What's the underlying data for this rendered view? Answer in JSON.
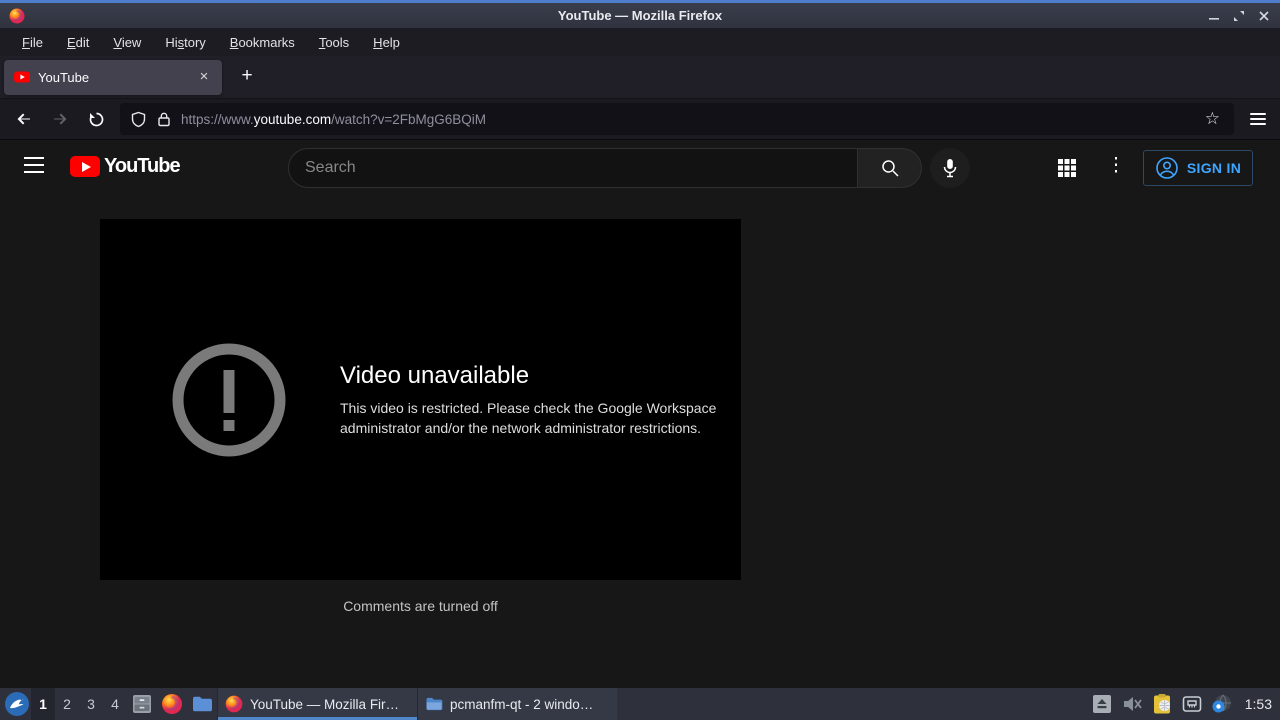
{
  "window": {
    "title": "YouTube — Mozilla Firefox"
  },
  "menubar": {
    "items": [
      {
        "pre": "",
        "key": "F",
        "rest": "ile"
      },
      {
        "pre": "",
        "key": "E",
        "rest": "dit"
      },
      {
        "pre": "",
        "key": "V",
        "rest": "iew"
      },
      {
        "pre": "Hi",
        "key": "s",
        "rest": "tory"
      },
      {
        "pre": "",
        "key": "B",
        "rest": "ookmarks"
      },
      {
        "pre": "",
        "key": "T",
        "rest": "ools"
      },
      {
        "pre": "",
        "key": "H",
        "rest": "elp"
      }
    ]
  },
  "tab": {
    "label": "YouTube"
  },
  "icons": {
    "close": "×",
    "new_tab": "+",
    "bookmark_star": "☆",
    "more_vertical": "⋮"
  },
  "navbar": {
    "url": {
      "scheme": "https://www.",
      "domain": "youtube.com",
      "path": "/watch?v=2FbMgG6BQiM"
    }
  },
  "masthead": {
    "logo_text": "YouTube",
    "search_placeholder": "Search",
    "signin_label": "SIGN IN"
  },
  "player": {
    "error_title": "Video unavailable",
    "error_message": "This video is restricted. Please check the Google Workspace administrator and/or the network administrator restrictions."
  },
  "comments_text": "Comments are turned off",
  "taskbar": {
    "workspaces": [
      "1",
      "2",
      "3",
      "4"
    ],
    "active_workspace": "1",
    "tasks": [
      {
        "label": "YouTube — Mozilla Fir…",
        "active": true
      },
      {
        "label": "pcmanfm-qt - 2 windo…",
        "active": false
      }
    ],
    "clock": "1:53"
  },
  "colors": {
    "titlebar_accent": "#4e7dcb",
    "youtube_red": "#ff0000",
    "signin_blue": "#3ea6ff",
    "task_active_underline": "#4f87c9"
  }
}
